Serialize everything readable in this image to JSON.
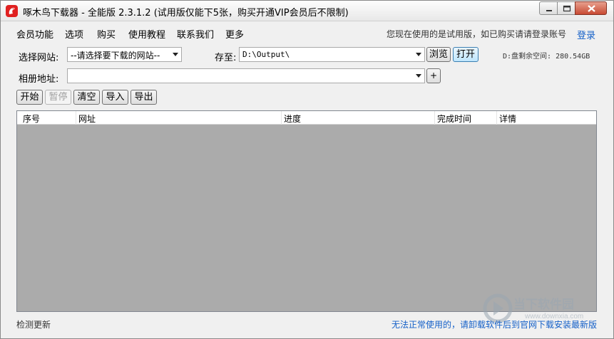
{
  "window": {
    "title": "啄木鸟下载器 - 全能版 2.3.1.2 (试用版仅能下5张，购买开通VIP会员后不限制)"
  },
  "menu": {
    "items": [
      "会员功能",
      "选项",
      "购买",
      "使用教程",
      "联系我们",
      "更多"
    ],
    "trial_note": "您现在使用的是试用版，如已购买请请登录账号",
    "login": "登录"
  },
  "site": {
    "label": "选择网站:",
    "value": "--请选择要下载的网站--"
  },
  "save": {
    "label": "存至:",
    "path": "D:\\Output\\",
    "browse": "浏览",
    "open": "打开",
    "disk_info": "D:盘剩余空间: 280.54GB"
  },
  "album": {
    "label": "相册地址:",
    "value": "",
    "add": "+"
  },
  "toolbar": {
    "start": "开始",
    "pause": "暂停",
    "clear": "清空",
    "import": "导入",
    "export": "导出"
  },
  "table": {
    "columns": [
      "序号",
      "网址",
      "进度",
      "完成时间",
      "详情"
    ]
  },
  "footer": {
    "check_update": "检测更新",
    "note": "无法正常使用的，请卸载软件后到官网下载安装最新版"
  },
  "watermark": {
    "text": "当下软件园",
    "url": "www.downxia.com"
  },
  "colors": {
    "link": "#1560c8",
    "list_bg": "#ababab",
    "app_icon": "#e02020"
  }
}
